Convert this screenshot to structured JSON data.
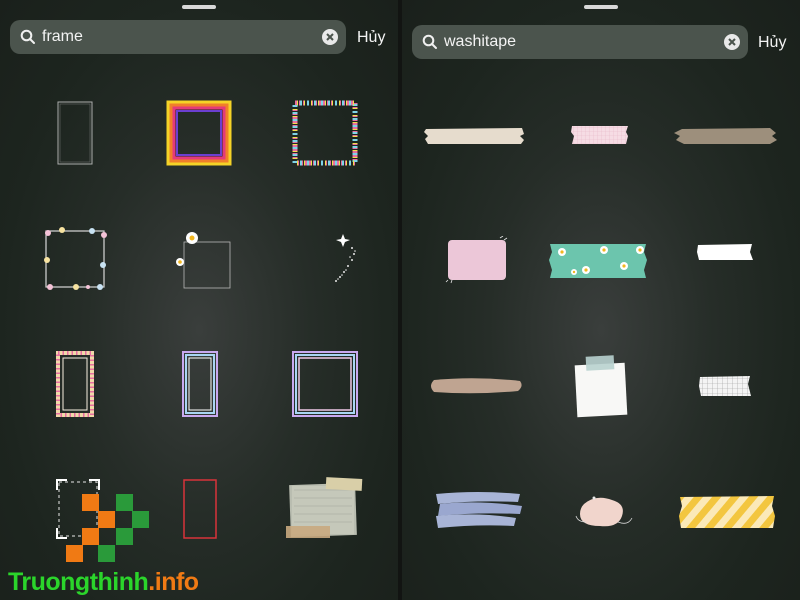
{
  "left_panel": {
    "search": {
      "value": "frame"
    },
    "cancel_label": "Hủy",
    "stickers": [
      "thin-white-frame",
      "rainbow-square-frame",
      "confetti-frame",
      "flower-vine-frame",
      "daisy-frame",
      "sparkle-trail",
      "polka-dot-frame",
      "pastel-lines-frame",
      "pastel-lines-square-frame",
      "photo-corners-frame",
      "red-outline-frame",
      "collage-paper-frame"
    ]
  },
  "right_panel": {
    "search": {
      "value": "washitape"
    },
    "cancel_label": "Hủy",
    "stickers": [
      "beige-tape",
      "pink-grid-tape",
      "brown-tape",
      "pink-sticky-note",
      "daisy-tape",
      "white-tape",
      "tan-brush-tape",
      "white-note-with-tape",
      "grid-tape",
      "blue-brush-tape",
      "pink-blob-doodle",
      "yellow-stripe-tape"
    ]
  },
  "watermark": {
    "part1": "Truongthinh",
    "part2": ".info"
  },
  "colors": {
    "search_bg": "#4b544d",
    "cancel_text": "#f3f3f3",
    "watermark_green": "#2bd52b",
    "watermark_orange": "#f07a14"
  }
}
